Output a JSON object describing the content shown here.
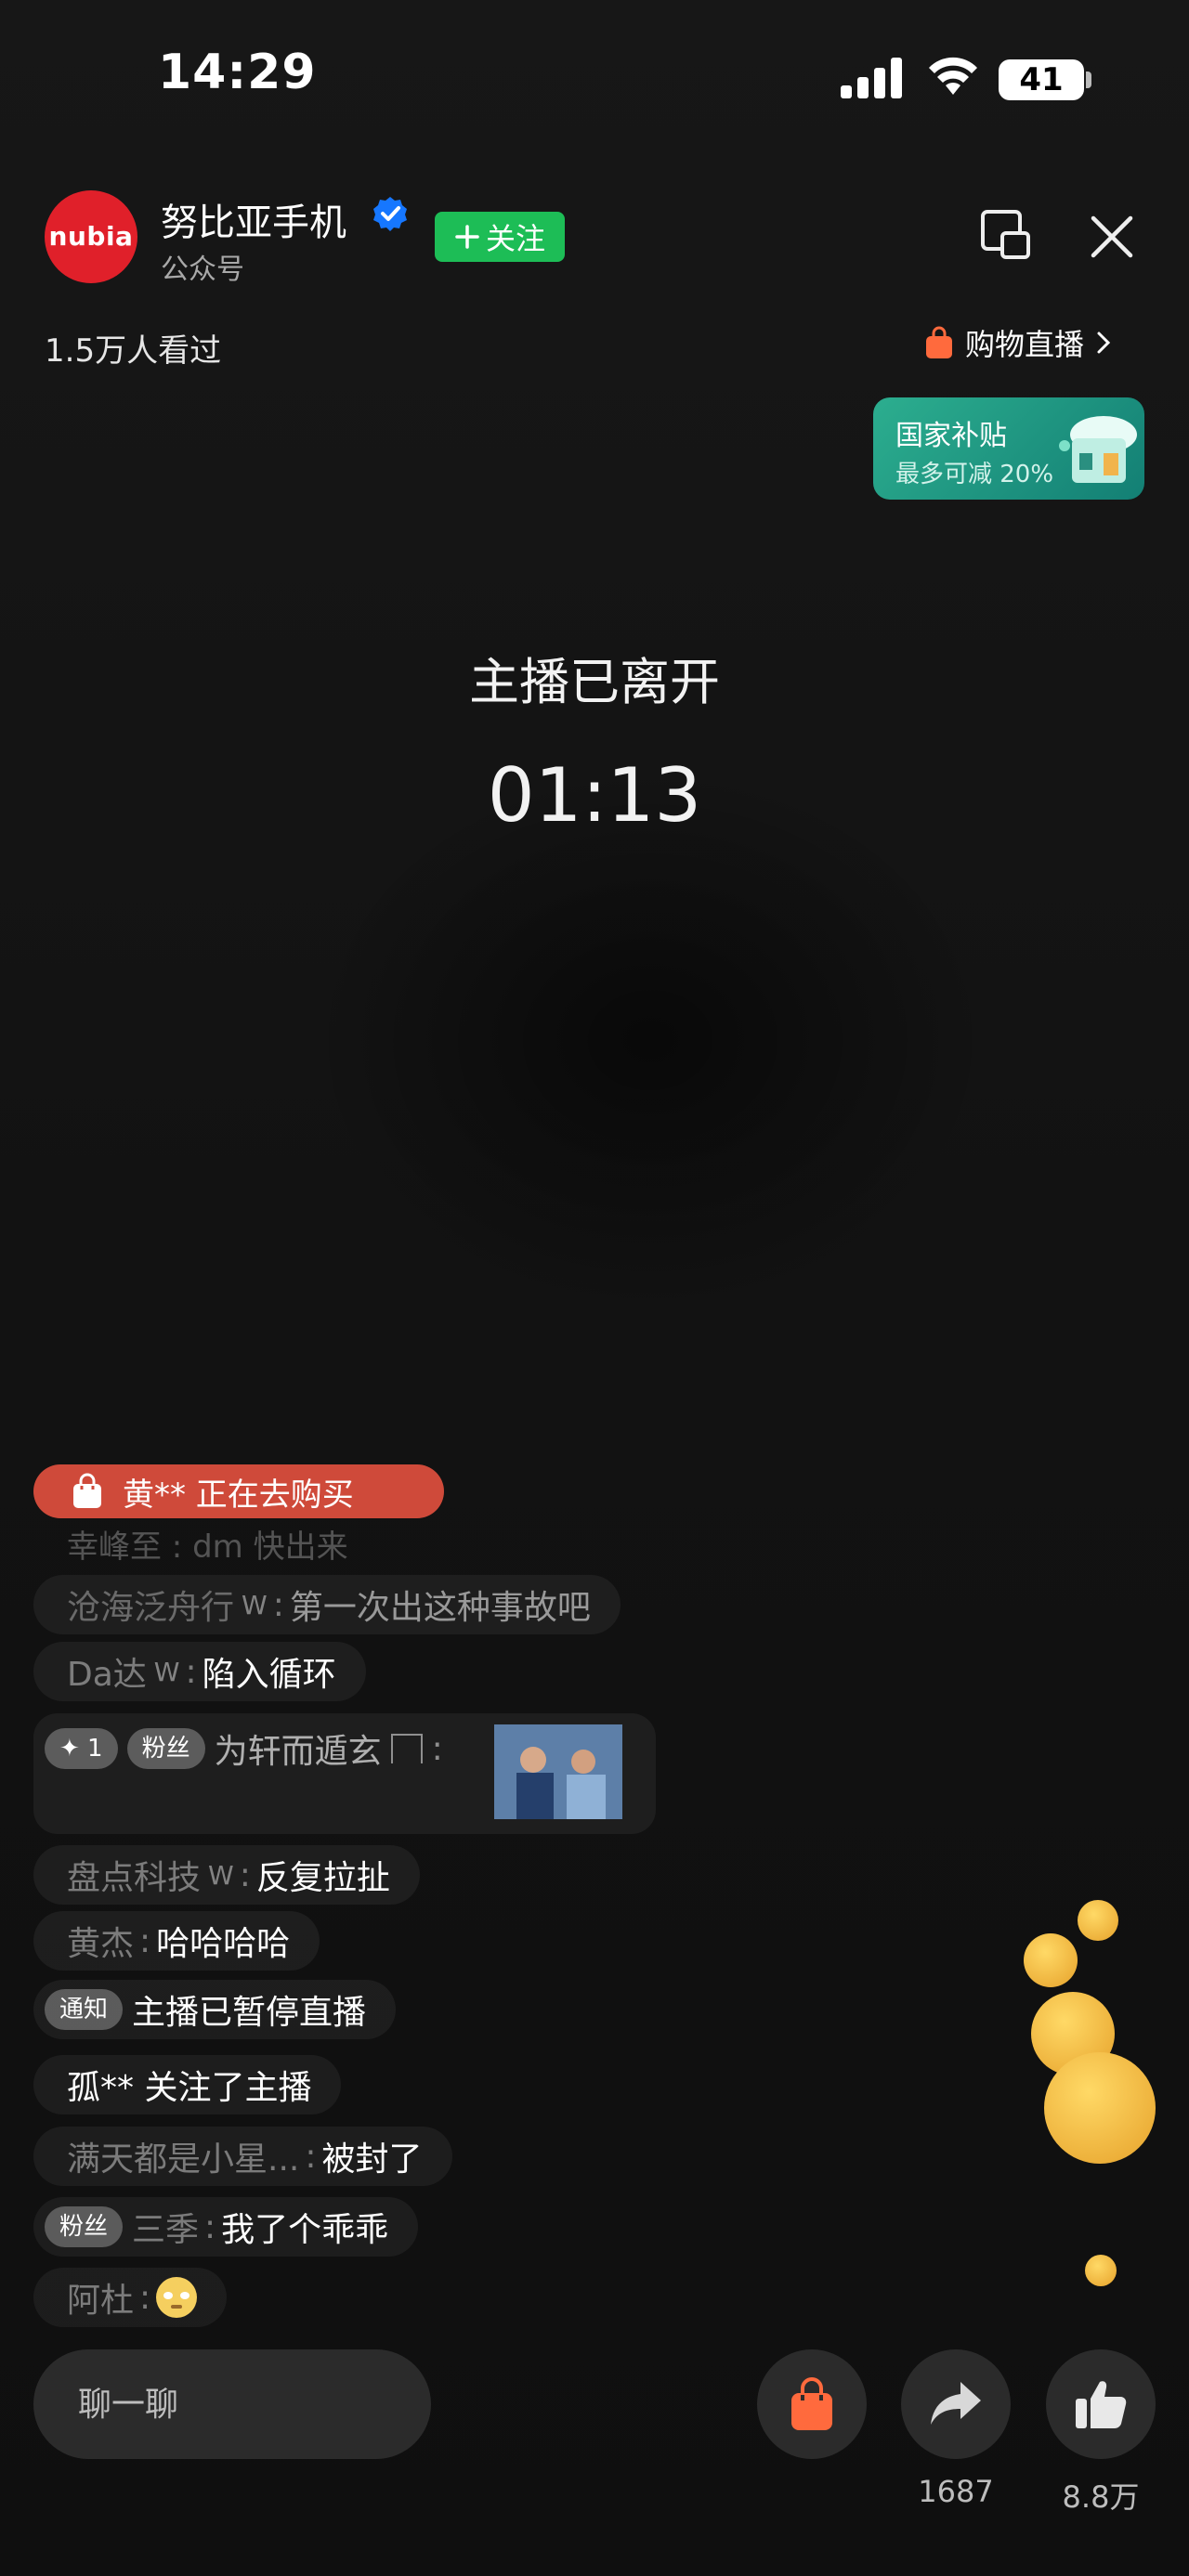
{
  "status_bar": {
    "time": "14:29",
    "battery": "41"
  },
  "header": {
    "logo_text": "nubia",
    "channel_name": "努比亚手机",
    "channel_type": "公众号",
    "follow_label": "关注",
    "viewers": "1.5万人看过",
    "shop_live_label": "购物直播"
  },
  "subsidy_banner": {
    "title": "国家补贴",
    "subtitle": "最多可减 20%"
  },
  "stream": {
    "status": "主播已离开",
    "timer": "01:13"
  },
  "comments": {
    "buying_notice": "黄** 正在去购买",
    "faded_row": "幸峰至 : dm 快出来",
    "rows": [
      {
        "user": "沧海泛舟行",
        "message": "第一次出这种事故吧"
      },
      {
        "user": "Da达",
        "message": "陷入循环"
      },
      {
        "badge1": "✦ 1",
        "badge2": "粉丝",
        "user": "为轩而遁玄",
        "message": ""
      },
      {
        "user": "盘点科技",
        "message": "反复拉扯"
      },
      {
        "user": "黄杰",
        "message": "哈哈哈哈"
      },
      {
        "badge": "通知",
        "message": "主播已暂停直播"
      },
      {
        "message": "孤** 关注了主播"
      },
      {
        "user": "满天都是小星...",
        "message": "被封了"
      },
      {
        "badge": "粉丝",
        "user": "三季",
        "message": "我了个乖乖"
      },
      {
        "user": "阿杜",
        "message": ""
      }
    ],
    "w_mark": "W"
  },
  "bottom_bar": {
    "chat_placeholder": "聊一聊",
    "share_count": "1687",
    "like_count": "8.8万"
  },
  "colors": {
    "accent_green": "#1dbd56",
    "logo_red": "#e0202a",
    "buy_banner": "#cf4a3a",
    "bag_orange": "#ff6a3d",
    "verified_blue": "#1677ff"
  },
  "icons": [
    "signal-icon",
    "wifi-icon",
    "verified-icon",
    "plus-icon",
    "pip-icon",
    "close-icon",
    "shopping-bag-icon",
    "chevron-right-icon",
    "house-icon",
    "share-icon",
    "thumbs-up-icon",
    "emoji-icon"
  ]
}
